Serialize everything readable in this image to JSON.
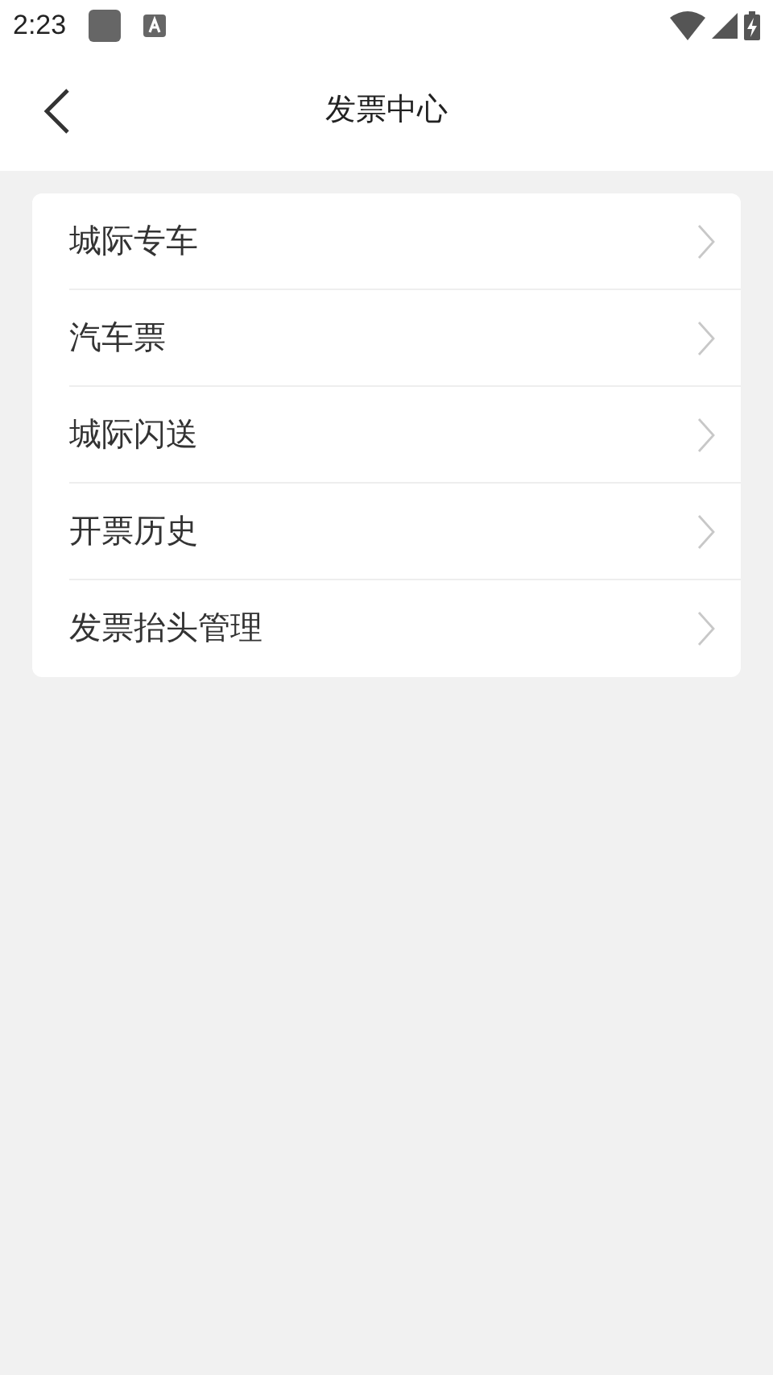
{
  "status_bar": {
    "time": "2:23"
  },
  "header": {
    "title": "发票中心"
  },
  "menu": [
    {
      "label": "城际专车"
    },
    {
      "label": "汽车票"
    },
    {
      "label": "城际闪送"
    },
    {
      "label": "开票历史"
    },
    {
      "label": "发票抬头管理"
    }
  ]
}
